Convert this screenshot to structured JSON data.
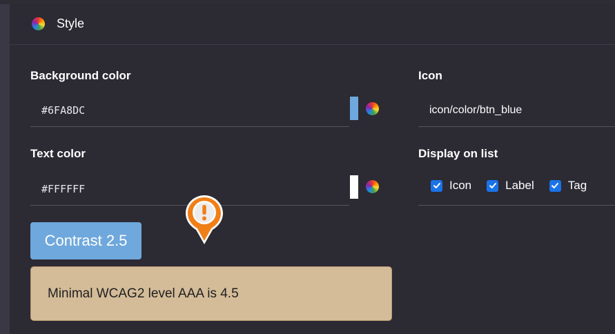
{
  "header": {
    "title": "Style",
    "icon": "color-wheel-icon"
  },
  "background_color": {
    "label": "Background color",
    "value": "#6FA8DC",
    "swatch": "#6FA8DC"
  },
  "text_color": {
    "label": "Text color",
    "value": "#FFFFFF",
    "swatch": "#FFFFFF"
  },
  "icon_field": {
    "label": "Icon",
    "value": "icon/color/btn_blue"
  },
  "display_on_list": {
    "label": "Display on list",
    "options": [
      {
        "label": "Icon",
        "checked": true
      },
      {
        "label": "Label",
        "checked": true
      },
      {
        "label": "Tag",
        "checked": true
      }
    ]
  },
  "contrast": {
    "label": "Contrast 2.5",
    "background": "#6FA8DC",
    "text": "#FFFFFF"
  },
  "warning": {
    "message": "Minimal WCAG2 level AAA is 4.5",
    "background": "#D4BC99",
    "marker_icon": "exclamation-icon",
    "marker_color": "#F07F17"
  },
  "colors": {
    "panel": "#2C2A33",
    "accent": "#1A73E8"
  }
}
